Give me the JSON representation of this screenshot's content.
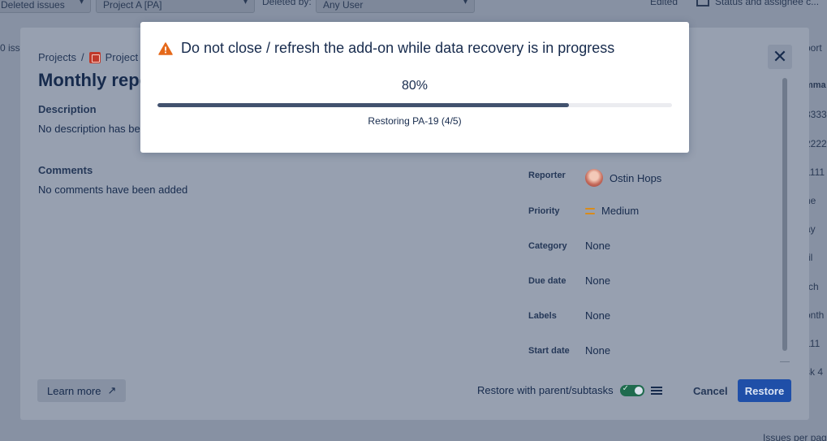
{
  "background": {
    "filters": {
      "select1": "Deleted issues",
      "select2": "Project A [PA]",
      "deleted_by_label": "Deleted by:",
      "deleted_by_value": "Any User",
      "edited_label": "Edited",
      "columns_label": "Status and assignee c..."
    },
    "left_partial": "0 issu",
    "right_column": [
      "port",
      "mma",
      "3333",
      "2222",
      "1111",
      "ne",
      "ay",
      "ril",
      "rch",
      "onth",
      "111",
      "sk 4"
    ],
    "bottom_right": "Issues per pag"
  },
  "issue": {
    "breadcrumb": {
      "projects": "Projects",
      "separator": "/",
      "project": "Project"
    },
    "title": "Monthly repo",
    "description_label": "Description",
    "description_text": "No description has bee",
    "comments_label": "Comments",
    "comments_text": "No comments have been added",
    "fields": [
      {
        "label": "Reporter",
        "value": "Ostin Hops",
        "icon": "avatar"
      },
      {
        "label": "Priority",
        "value": "Medium",
        "icon": "priority-medium-icon"
      },
      {
        "label": "Category",
        "value": "None"
      },
      {
        "label": "Due date",
        "value": "None"
      },
      {
        "label": "Labels",
        "value": "None"
      },
      {
        "label": "Start date",
        "value": "None"
      }
    ],
    "footer": {
      "learn_more": "Learn more",
      "restore_option": "Restore with parent/subtasks",
      "cancel": "Cancel",
      "restore": "Restore"
    }
  },
  "progress": {
    "title": "Do not close / refresh the add-on while data recovery is in progress",
    "percent_text": "80%",
    "fraction": 0.8,
    "status": "Restoring PA-19 (4/5)",
    "colors": {
      "warning": "#e5691a",
      "bar_fill": "#42526e",
      "bar_track": "#ebecf0"
    }
  }
}
